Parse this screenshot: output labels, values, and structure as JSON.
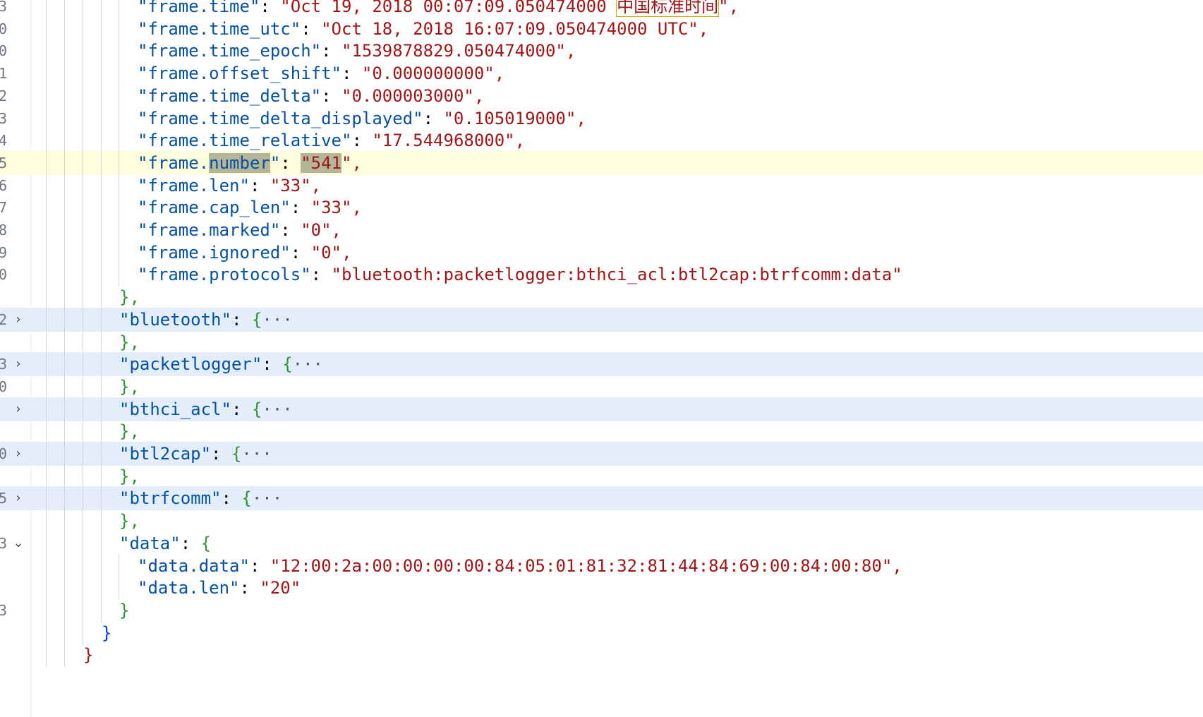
{
  "editor": {
    "lines": [
      {
        "gutter": "3",
        "key": "\"frame.time\"",
        "value": "\"Oct 19, 2018 00:07:09.050474000 中国标准时间\","
      },
      {
        "gutter": "0",
        "key": "\"frame.time_utc\"",
        "value": "\"Oct 18, 2018 16:07:09.050474000 UTC\","
      },
      {
        "gutter": "0",
        "key": "\"frame.time_epoch\"",
        "value": "\"1539878829.050474000\","
      },
      {
        "gutter": "1",
        "key": "\"frame.offset_shift\"",
        "value": "\"0.000000000\","
      },
      {
        "gutter": "2",
        "key": "\"frame.time_delta\"",
        "value": "\"0.000003000\","
      },
      {
        "gutter": "3",
        "key": "\"frame.time_delta_displayed\"",
        "value": "\"0.105019000\","
      },
      {
        "gutter": "4",
        "key": "\"frame.time_relative\"",
        "value": "\"17.544968000\","
      },
      {
        "gutter": "5",
        "key_prefix": "\"frame.",
        "key_sel": "number",
        "key_suffix": "\"",
        "value_sel": "\"541",
        "value_end": "\","
      },
      {
        "gutter": "6",
        "key": "\"frame.len\"",
        "value": "\"33\","
      },
      {
        "gutter": "7",
        "key": "\"frame.cap_len\"",
        "value": "\"33\","
      },
      {
        "gutter": "8",
        "key": "\"frame.marked\"",
        "value": "\"0\","
      },
      {
        "gutter": "9",
        "key": "\"frame.ignored\"",
        "value": "\"0\","
      },
      {
        "gutter": "0",
        "key": "\"frame.protocols\"",
        "value": "\"bluetooth:packetlogger:bthci_acl:btl2cap:btrfcomm:data\""
      }
    ],
    "close_brace_comma": "},",
    "folded_sections": [
      {
        "gutter": "2",
        "key": "\"bluetooth\"",
        "gutter_close": "",
        "ellipsis": "···"
      },
      {
        "gutter": "3",
        "key": "\"packetlogger\"",
        "gutter_close": "0",
        "ellipsis": "···"
      },
      {
        "gutter": "",
        "key": "\"bthci_acl\"",
        "gutter_close": "",
        "ellipsis": "···"
      },
      {
        "gutter": "0",
        "key": "\"btl2cap\"",
        "gutter_close": "",
        "ellipsis": "···"
      },
      {
        "gutter": "5",
        "key": "\"btrfcomm\"",
        "gutter_close": "",
        "ellipsis": "···"
      }
    ],
    "data_section": {
      "gutter": "3",
      "key": "\"data\"",
      "items": [
        {
          "gutter": "",
          "key": "\"data.data\"",
          "value": "\"12:00:2a:00:00:00:00:84:05:01:81:32:81:44:84:69:00:84:00:80\","
        },
        {
          "gutter": "",
          "key": "\"data.len\"",
          "value": "\"20\""
        }
      ],
      "close": "}",
      "gutter_close": "3"
    },
    "outer_close_1": "}",
    "outer_close_2": "}"
  }
}
